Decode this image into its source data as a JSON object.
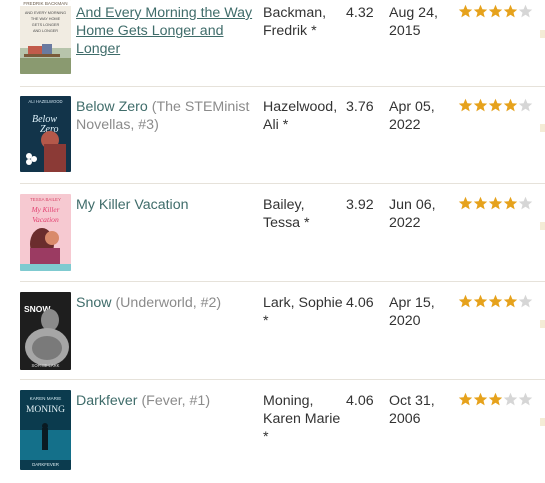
{
  "colors": {
    "title_link": "#3f6c6a",
    "series_text": "#8b8b8b",
    "body_text": "#333333",
    "star_filled": "#e6a21c",
    "star_empty": "#d6d6d6",
    "divider": "#e6e2da"
  },
  "books": [
    {
      "title": "And Every Morning the Way Home Gets Longer and Longer",
      "series": "",
      "author": "Backman, Fredrik",
      "author_mark": "*",
      "avg_rating": "4.32",
      "date_line1": "Aug 24,",
      "date_line2": "2015",
      "stars_filled": 4,
      "cover_top_text": "FREDRIK BACKMAN",
      "cover_lines": [
        "AND EVERY MORNING",
        "THE WAY HOME",
        "GETS LONGER",
        "AND LONGER"
      ]
    },
    {
      "title": "Below Zero",
      "series": "(The STEMinist Novellas, #3)",
      "author": "Hazelwood, Ali",
      "author_mark": "*",
      "avg_rating": "3.76",
      "date_line1": "Apr 05,",
      "date_line2": "2022",
      "stars_filled": 4,
      "cover_top_text": "ALI HAZELWOOD",
      "cover_lines": [
        "Below",
        "Zero"
      ]
    },
    {
      "title": "My Killer Vacation",
      "series": "",
      "author": "Bailey, Tessa",
      "author_mark": "*",
      "avg_rating": "3.92",
      "date_line1": "Jun 06,",
      "date_line2": "2022",
      "stars_filled": 4,
      "cover_top_text": "TESSA BAILEY",
      "cover_lines": [
        "My Killer",
        "Vacation"
      ]
    },
    {
      "title": "Snow",
      "series": "(Underworld, #2)",
      "author": "Lark, Sophie",
      "author_mark": "*",
      "avg_rating": "4.06",
      "date_line1": "Apr 15,",
      "date_line2": "2020",
      "stars_filled": 4,
      "cover_top_text": "SNOW",
      "cover_lines": [
        "SOPHIE LARK"
      ]
    },
    {
      "title": "Darkfever",
      "series": "(Fever, #1)",
      "author": "Moning, Karen Marie",
      "author_mark": "*",
      "avg_rating": "4.06",
      "date_line1": "Oct 31,",
      "date_line2": "2006",
      "stars_filled": 3,
      "cover_top_text": "KAREN MARIE",
      "cover_lines": [
        "MONING",
        "DARKFEVER"
      ]
    }
  ]
}
